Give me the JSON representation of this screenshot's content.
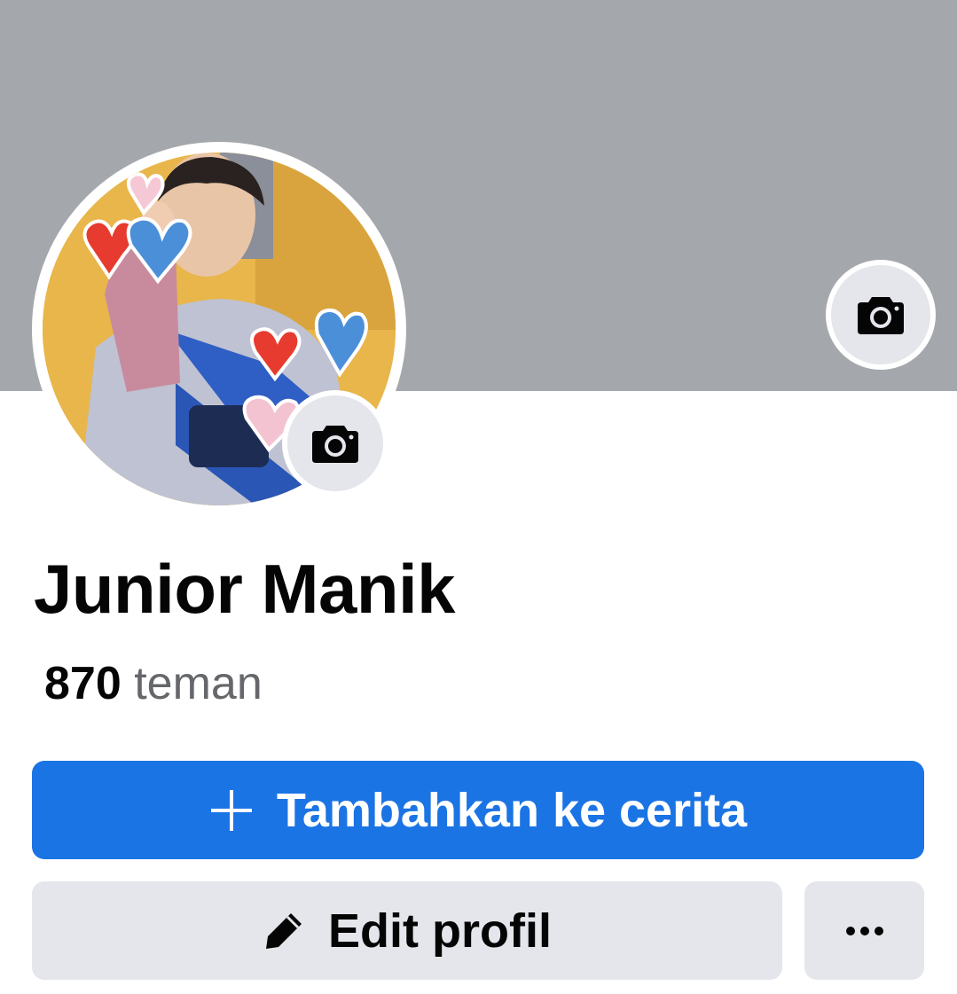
{
  "profile": {
    "name": "Junior Manik",
    "friends_count": "870",
    "friends_label": "teman"
  },
  "actions": {
    "add_story_label": "Tambahkan ke cerita",
    "edit_profile_label": "Edit profil"
  },
  "icons": {
    "cover_camera": "camera-icon",
    "avatar_camera": "camera-icon",
    "add_story": "plus-icon",
    "edit_profile": "pencil-icon",
    "more": "more-icon"
  },
  "colors": {
    "cover_bg": "#a4a7ab",
    "primary_button": "#1b74e4",
    "secondary_button": "#e4e6eb",
    "muted_text": "#65676b"
  }
}
